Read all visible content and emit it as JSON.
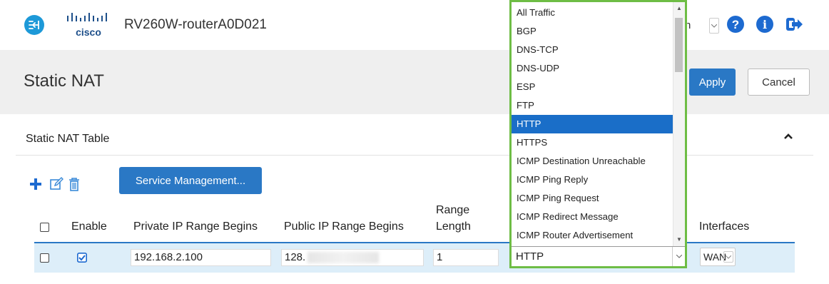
{
  "header": {
    "device_name": "RV260W-routerA0D021",
    "logo_text": "cisco",
    "hdr_select_value": "n"
  },
  "page": {
    "title": "Static NAT",
    "apply_label": "Apply",
    "cancel_label": "Cancel"
  },
  "panel": {
    "title": "Static NAT Table",
    "service_mgmt_label": "Service Management..."
  },
  "table": {
    "columns": {
      "enable": "Enable",
      "private_ip": "Private IP Range Begins",
      "public_ip": "Public IP Range Begins",
      "range_length_1": "Range",
      "range_length_2": "Length",
      "interfaces": "Interfaces"
    },
    "rows": [
      {
        "selected": false,
        "enabled": true,
        "private_ip": "192.168.2.100",
        "public_ip": "128.",
        "range_length": "1",
        "service": "HTTP",
        "interface": "WAN"
      }
    ]
  },
  "service_dropdown": {
    "options": [
      "All Traffic",
      "BGP",
      "DNS-TCP",
      "DNS-UDP",
      "ESP",
      "FTP",
      "HTTP",
      "HTTPS",
      "ICMP Destination Unreachable",
      "ICMP Ping Reply",
      "ICMP Ping Request",
      "ICMP Redirect Message",
      "ICMP Router Advertisement"
    ],
    "selected": "HTTP"
  },
  "colors": {
    "accent": "#1d99d8",
    "primary_button": "#2a78c5",
    "dropdown_highlight_border": "#6ebd45",
    "selected_option": "#1a6ec8",
    "row_bg": "#ddeef9"
  },
  "icons": [
    "nav-toggle-icon",
    "cisco-logo",
    "help-icon",
    "info-icon",
    "logout-icon",
    "collapse-up-icon",
    "add-icon",
    "edit-icon",
    "delete-icon"
  ]
}
